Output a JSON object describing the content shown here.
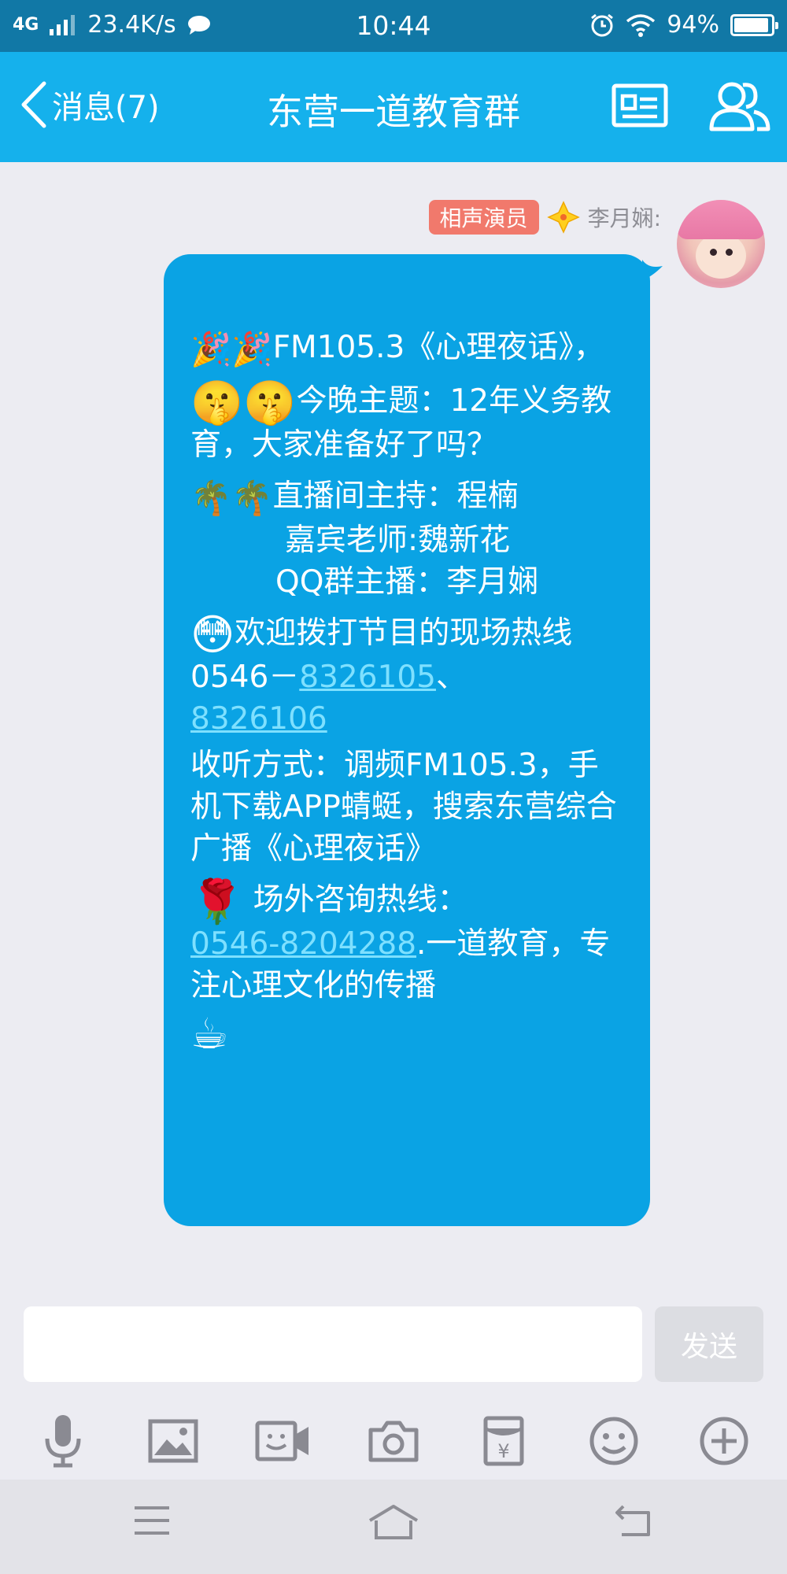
{
  "status_bar": {
    "network": "4G",
    "speed": "23.4K/s",
    "time": "10:44",
    "battery": "94%",
    "battery_level": 0.94
  },
  "header": {
    "back_label": "消息(7)",
    "title": "东营一道教育群"
  },
  "message": {
    "sender_badge": "相声演员",
    "sender_name": "李月娴:",
    "line1": "FM105.3《心理夜话》，",
    "line2": "今晚主题：12年义务教育，大家准备好了吗？",
    "line3a": "直播间主持：程楠",
    "line3b": "嘉宾老师:魏新花",
    "line3c": "QQ群主播：李月娴",
    "line4a": "欢迎拨打节目的现场热线0546－",
    "phone1": "8326105",
    "sep1": "、",
    "phone2": "8326106",
    "line5": "收听方式：调频FM105.3，手机下载APP蜻蜓，搜索东营综合广播《心理夜话》",
    "line6a": "场外咨询热线：",
    "phone3": "0546-8204288",
    "line6b": ".一道教育，专注心理文化的传播",
    "emoji_party": "🎉🎉",
    "emoji_shush": "🤫🤫",
    "emoji_palm": "🌴🌴",
    "emoji_dizzy": "😳",
    "emoji_rose": "🌹",
    "emoji_coffee": "☕"
  },
  "input": {
    "placeholder": "",
    "send_label": "发送"
  },
  "colors": {
    "status_bar": "#1178a6",
    "header": "#15b1ec",
    "bubble": "#0aa3e4",
    "badge": "#f1796c",
    "link": "#7ee0ff"
  }
}
